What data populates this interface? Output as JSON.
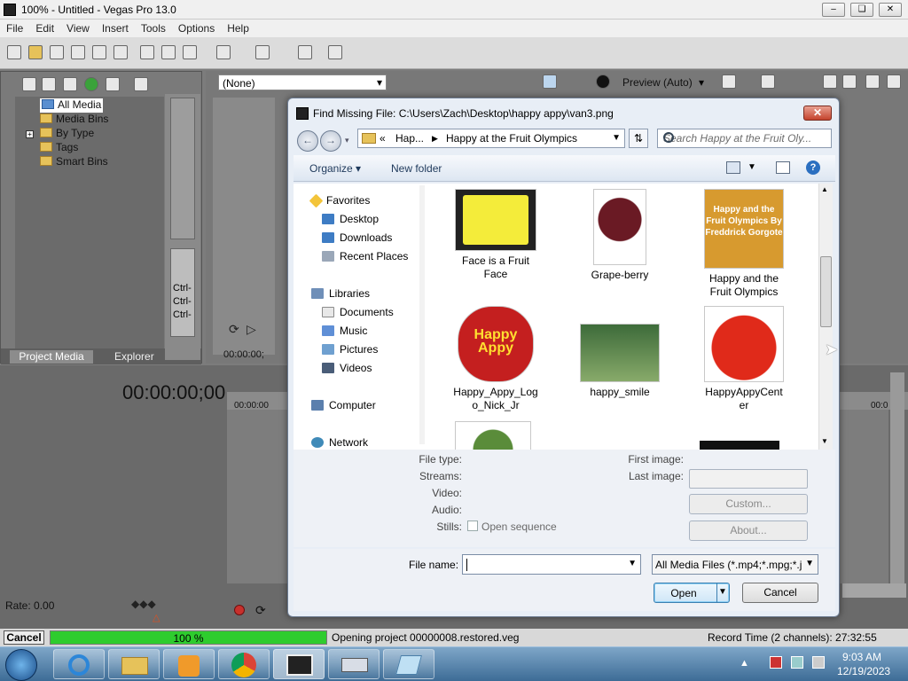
{
  "window": {
    "title": "100% - Untitled - Vegas Pro 13.0"
  },
  "menu": [
    "File",
    "Edit",
    "View",
    "Insert",
    "Tools",
    "Options",
    "Help"
  ],
  "preview_toolbar": {
    "track_select": "(None)",
    "preview_quality": "Preview (Auto)"
  },
  "explorer_tree": [
    "All Media",
    "Media Bins",
    "By Type",
    "Tags",
    "Smart Bins"
  ],
  "panel_tabs": {
    "project_media": "Project Media",
    "explorer": "Explorer"
  },
  "ctrl_labels": [
    "Ctrl-",
    "Ctrl-",
    "Ctrl-"
  ],
  "timecode": "00:00:00;00",
  "preview_time": "00:00:00;",
  "ruler_start": "00:00:00",
  "ruler_end": "00:0",
  "rate_label": "Rate: 0.00",
  "dialog": {
    "title": "Find Missing File: C:\\Users\\Zach\\Desktop\\happy appy\\van3.png",
    "address": {
      "prefix": "«",
      "crumb1": "Hap...",
      "crumb2": "Happy at the Fruit Olympics"
    },
    "search_placeholder": "Search Happy at the Fruit Oly...",
    "commands": {
      "organize": "Organize",
      "new_folder": "New folder"
    },
    "nav": {
      "favorites": "Favorites",
      "desktop": "Desktop",
      "downloads": "Downloads",
      "recent_places": "Recent Places",
      "libraries": "Libraries",
      "documents": "Documents",
      "music": "Music",
      "pictures": "Pictures",
      "videos": "Videos",
      "computer": "Computer",
      "network": "Network"
    },
    "files": [
      {
        "name": "Face is a Fruit Face",
        "line1": "Face is a Fruit",
        "line2": "Face"
      },
      {
        "name": "Grape-berry",
        "line1": "Grape-berry",
        "line2": ""
      },
      {
        "name": "Happy and the Fruit Olympics",
        "line1": "Happy and the",
        "line2": "Fruit Olympics",
        "thumb_text": "Happy and the Fruit Olympics By Freddrick Gorgote"
      },
      {
        "name": "Happy_Appy_Logo_Nick_Jr",
        "line1": "Happy_Appy_Log",
        "line2": "o_Nick_Jr",
        "thumb_text": "Happy Appy"
      },
      {
        "name": "happy_smile",
        "line1": "happy_smile",
        "line2": ""
      },
      {
        "name": "HappyAppyCenter",
        "line1": "HappyAppyCent",
        "line2": "er"
      }
    ],
    "details": {
      "file_type": "File type:",
      "streams": "Streams:",
      "video": "Video:",
      "audio": "Audio:",
      "stills": "Stills:",
      "open_sequence": "Open sequence",
      "first_image": "First image:",
      "last_image": "Last image:",
      "custom_button": "Custom...",
      "about_button": "About..."
    },
    "file_name_label": "File name:",
    "file_name_value": "",
    "filter": "All Media Files (*.mp4;*.mpg;*.j",
    "open_button": "Open",
    "cancel_button": "Cancel"
  },
  "status": {
    "cancel": "Cancel",
    "progress_text": "100 %",
    "progress": 1.0,
    "message": "Opening project 00000008.restored.veg",
    "record_time": "Record Time (2 channels): 27:32:55"
  },
  "taskbar": {
    "time": "9:03 AM",
    "date": "12/19/2023"
  },
  "colors": {
    "dialog_bg": "#e8eef6",
    "vegas_panel": "#6f6f6f",
    "progress_green": "#2ecc2e",
    "taskbar": "#3d6c96"
  }
}
